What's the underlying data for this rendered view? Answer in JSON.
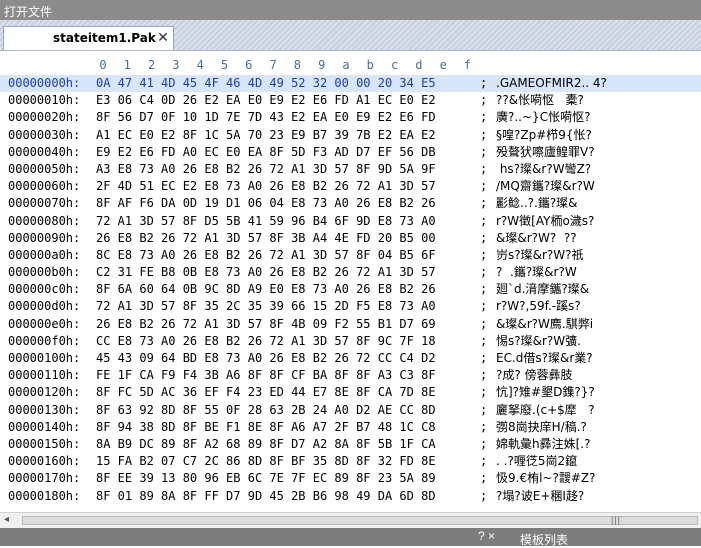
{
  "window": {
    "title": "打开文件"
  },
  "tab": {
    "label": "stateitem1.Pak",
    "close_glyph": "✕"
  },
  "ruler": {
    "columns": [
      "0",
      "1",
      "2",
      "3",
      "4",
      "5",
      "6",
      "7",
      "8",
      "9",
      "a",
      "b",
      "c",
      "d",
      "e",
      "f"
    ]
  },
  "hex_rows": [
    {
      "addr": "00000000h:",
      "hex": "0A 47 41 4D 45 4F 46 4D 49 52 32 00 00 20 34 E5",
      "ascii": ".GAMEOFMIR2.. 4?"
    },
    {
      "addr": "00000010h:",
      "hex": "E3 06 C4 0D 26 E2 EA E0 E9 E2 E6 FD A1 EC E0 E2",
      "ascii": "??&怅嗬怄   橐?"
    },
    {
      "addr": "00000020h:",
      "hex": "8F 56 D7 0F 10 1D 7E 7D 43 E2 EA E0 E9 E2 E6 FD",
      "ascii": "廣?..~}C怅嗬怄?"
    },
    {
      "addr": "00000030h:",
      "hex": "A1 EC E0 E2 8F 1C 5A 70 23 E9 B7 39 7B E2 EA E2",
      "ascii": "§喤?Zp#栉9{怅?"
    },
    {
      "addr": "00000040h:",
      "hex": "E9 E2 E6 FD A0 EC E0 EA 8F 5D F3 AD D7 EF 56 DB",
      "ascii": "殁聱犾嚓廬鳇罪V?"
    },
    {
      "addr": "00000050h:",
      "hex": "A3 E8 73 A0 26 E8 B2 26 72 A1 3D 57 8F 9D 5A 9F",
      "ascii": " hs?璨&r?W彎Z?"
    },
    {
      "addr": "00000060h:",
      "hex": "2F 4D 51 EC E2 E8 73 A0 26 E8 B2 26 72 A1 3D 57",
      "ascii": "/MQ齋鑴?璨&r?W"
    },
    {
      "addr": "00000070h:",
      "hex": "8F AF F6 DA 0D 19 D1 06 04 E8 73 A0 26 E8 B2 26",
      "ascii": "彲鲶..?.鑴?璨&"
    },
    {
      "addr": "00000080h:",
      "hex": "72 A1 3D 57 8F D5 5B 41 59 96 B4 6F 9D E8 73 A0",
      "ascii": "r?W徵[AY栭o濊s?"
    },
    {
      "addr": "00000090h:",
      "hex": "26 E8 B2 26 72 A1 3D 57 8F 3B A4 4E FD 20 B5 00",
      "ascii": "&璨&r?W?  ??"
    },
    {
      "addr": "000000a0h:",
      "hex": "8C E8 73 A0 26 E8 B2 26 72 A1 3D 57 8F 04 B5 6F",
      "ascii": "岃s?璨&r?W?祇"
    },
    {
      "addr": "000000b0h:",
      "hex": "C2 31 FE B8 0B E8 73 A0 26 E8 B2 26 72 A1 3D 57",
      "ascii": "?  .鑴?璨&r?W"
    },
    {
      "addr": "000000c0h:",
      "hex": "8F 6A 60 64 0B 9C 8D A9 E0 E8 73 A0 26 E8 B2 26",
      "ascii": "廻`d.湇摩鑴?璨&"
    },
    {
      "addr": "000000d0h:",
      "hex": "72 A1 3D 57 8F 35 2C 35 39 66 15 2D F5 E8 73 A0",
      "ascii": "r?W?,59f.-蹊s?"
    },
    {
      "addr": "000000e0h:",
      "hex": "26 E8 B2 26 72 A1 3D 57 8F 4B 09 F2 55 B1 D7 69",
      "ascii": "&璨&r?W廌.騏弊i"
    },
    {
      "addr": "000000f0h:",
      "hex": "CC E8 73 A0 26 E8 B2 26 72 A1 3D 57 8F 9C 7F 18",
      "ascii": "惕s?璨&r?W彍."
    },
    {
      "addr": "00000100h:",
      "hex": "45 43 09 64 BD E8 73 A0 26 E8 B2 26 72 CC C4 D2",
      "ascii": "EC.d借s?璨&r業?"
    },
    {
      "addr": "00000110h:",
      "hex": "FE 1F CA F9 F4 3B A6 8F 8F CF BA 8F 8F A3 C3 8F",
      "ascii": "?成? 傍蓉彝肢"
    },
    {
      "addr": "00000120h:",
      "hex": "8F FC 5D AC 36 EF F4 23 ED 44 E7 8E 8F CA 7D 8E",
      "ascii": "忼]?雉#墾D鏶?}?"
    },
    {
      "addr": "00000130h:",
      "hex": "8F 63 92 8D 8F 55 0F 28 63 2B 24 A0 D2 AE CC 8D",
      "ascii": "廲拏廢.(c+$犘   ?"
    },
    {
      "addr": "00000140h:",
      "hex": "8F 94 38 8D 8F BE F1 8E 8F A6 A7 2F B7 48 1C C8",
      "ascii": "彅8崗抉庠H/稿.?"
    },
    {
      "addr": "00000150h:",
      "hex": "8A B9 DC 89 8F A2 68 89 8F D7 A2 8A 8F 5B 1F CA",
      "ascii": "婂軌彙h彞注姝[.?"
    },
    {
      "addr": "00000160h:",
      "hex": "15 FA B2 07 C7 2C 86 8D 8F BF 35 8D 8F 32 FD 8E",
      "ascii": ". .?喱徔5崗2鑹"
    },
    {
      "addr": "00000170h:",
      "hex": "8F EE 39 13 80 96 EB 6C 7E 7F EC 89 8F 23 5A 89",
      "ascii": "忣9.€栯l~?靉#Z?"
    },
    {
      "addr": "00000180h:",
      "hex": "8F 01 89 8A 8F FF D7 9D 45 2B B6 98 49 DA 6D 8D",
      "ascii": "?塌?诐E+稛I趍?"
    }
  ],
  "separator": ";",
  "scrollbar": {
    "grip": "|||"
  },
  "bottom_panel": {
    "label": "模板列表",
    "tools": "? ×"
  }
}
